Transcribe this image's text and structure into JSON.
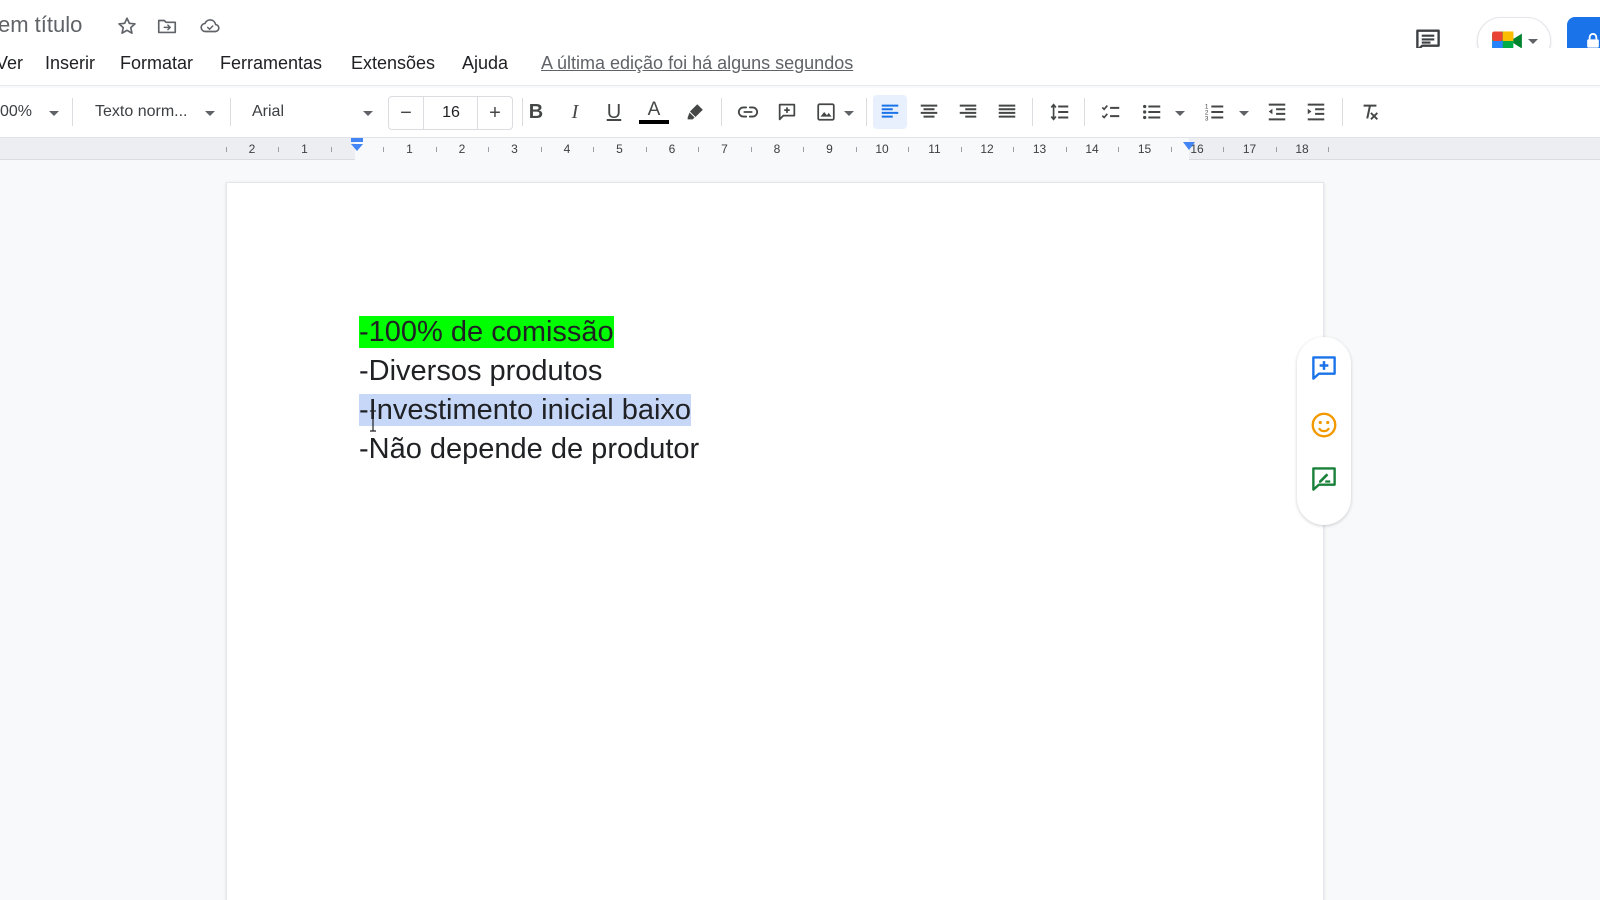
{
  "title": {
    "doc_title": "em título",
    "icons": [
      "star-icon",
      "move-folder-icon",
      "cloud-saved-icon"
    ]
  },
  "menu": {
    "items": [
      "Ver",
      "Inserir",
      "Formatar",
      "Ferramentas",
      "Extensões",
      "Ajuda"
    ],
    "last_edit": "A última edição foi há alguns segundos"
  },
  "toolbar": {
    "zoom": "00%",
    "style": "Texto norm...",
    "font": "Arial",
    "font_size": "16",
    "minus": "−",
    "plus": "+",
    "bold": "B",
    "italic": "I",
    "underline": "U",
    "text_color_glyph": "A",
    "text_color": "#000000"
  },
  "ruler": {
    "ticks": [
      "2",
      "1",
      "1",
      "2",
      "3",
      "4",
      "5",
      "6",
      "7",
      "8",
      "9",
      "10",
      "11",
      "12",
      "13",
      "14",
      "15",
      "16",
      "17",
      "18"
    ]
  },
  "document": {
    "lines": [
      "-100% de comissão",
      "-Diversos produtos",
      "-Investimento inicial baixo",
      "-Não depende de produtor"
    ],
    "highlight_color": "#00ff00",
    "selection_color": "#c6d7f7"
  },
  "colors": {
    "accent": "#1a73e8",
    "side_add_comment": "#1a73e8",
    "side_emoji": "#f29900",
    "side_suggest": "#188038"
  }
}
